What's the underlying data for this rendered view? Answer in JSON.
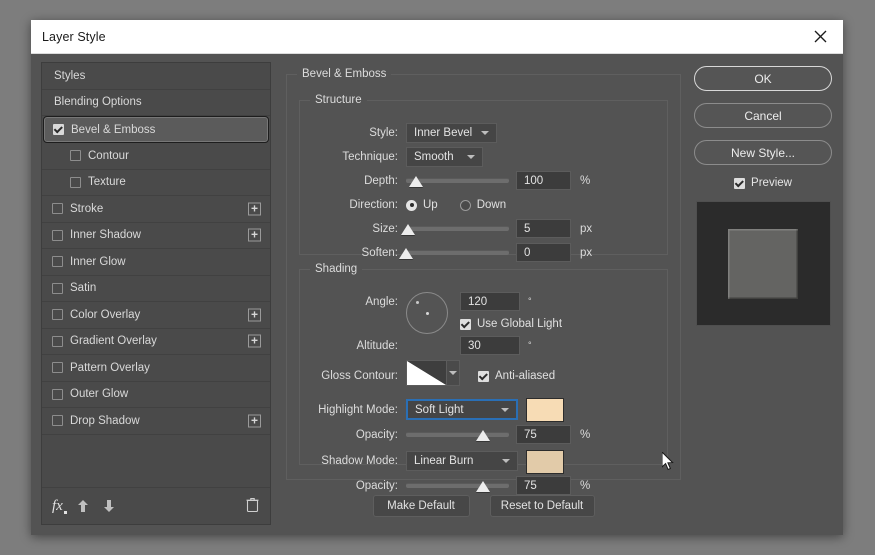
{
  "window": {
    "title": "Layer Style",
    "close_icon": "close-icon"
  },
  "styles_panel": {
    "items": [
      {
        "label": "Styles",
        "type": "plain",
        "checkbox": null,
        "plus": false
      },
      {
        "label": "Blending Options",
        "type": "plain",
        "checkbox": null,
        "plus": false
      },
      {
        "label": "Bevel & Emboss",
        "type": "selected",
        "checkbox": true,
        "plus": false
      },
      {
        "label": "Contour",
        "type": "indent",
        "checkbox": false,
        "plus": false
      },
      {
        "label": "Texture",
        "type": "indent",
        "checkbox": false,
        "plus": false
      },
      {
        "label": "Stroke",
        "type": "normal",
        "checkbox": false,
        "plus": true
      },
      {
        "label": "Inner Shadow",
        "type": "normal",
        "checkbox": false,
        "plus": true
      },
      {
        "label": "Inner Glow",
        "type": "normal",
        "checkbox": false,
        "plus": false
      },
      {
        "label": "Satin",
        "type": "normal",
        "checkbox": false,
        "plus": false
      },
      {
        "label": "Color Overlay",
        "type": "normal",
        "checkbox": false,
        "plus": true
      },
      {
        "label": "Gradient Overlay",
        "type": "normal",
        "checkbox": false,
        "plus": true
      },
      {
        "label": "Pattern Overlay",
        "type": "normal",
        "checkbox": false,
        "plus": false
      },
      {
        "label": "Outer Glow",
        "type": "normal",
        "checkbox": false,
        "plus": false
      },
      {
        "label": "Drop Shadow",
        "type": "normal",
        "checkbox": false,
        "plus": true
      }
    ],
    "footer": {
      "fx_icon": "fx-icon",
      "up_icon": "arrow-up-icon",
      "down_icon": "arrow-down-icon",
      "delete_icon": "trash-icon"
    }
  },
  "bevel_emboss": {
    "legend": "Bevel & Emboss",
    "structure": {
      "legend": "Structure",
      "style": {
        "label": "Style:",
        "value": "Inner Bevel"
      },
      "technique": {
        "label": "Technique:",
        "value": "Smooth"
      },
      "depth": {
        "label": "Depth:",
        "value": "100",
        "unit": "%",
        "percent": 10
      },
      "direction": {
        "label": "Direction:",
        "up_label": "Up",
        "down_label": "Down",
        "selected": "Up"
      },
      "size": {
        "label": "Size:",
        "value": "5",
        "unit": "px",
        "percent": 2
      },
      "soften": {
        "label": "Soften:",
        "value": "0",
        "unit": "px",
        "percent": 0
      }
    },
    "shading": {
      "legend": "Shading",
      "angle": {
        "label": "Angle:",
        "value": "120",
        "unit": "°"
      },
      "use_global_light": {
        "label": "Use Global Light",
        "checked": true
      },
      "altitude": {
        "label": "Altitude:",
        "value": "30",
        "unit": "°"
      },
      "gloss_contour": {
        "label": "Gloss Contour:"
      },
      "anti_aliased": {
        "label": "Anti-aliased",
        "checked": true
      },
      "highlight_mode": {
        "label": "Highlight Mode:",
        "value": "Soft Light",
        "color": "#f7dcb5",
        "focused": true
      },
      "highlight_opacity": {
        "label": "Opacity:",
        "value": "75",
        "unit": "%",
        "percent": 75
      },
      "shadow_mode": {
        "label": "Shadow Mode:",
        "value": "Linear Burn",
        "color": "#e2cba9"
      },
      "shadow_opacity": {
        "label": "Opacity:",
        "value": "75",
        "unit": "%",
        "percent": 75
      }
    }
  },
  "defaults": {
    "make_default": "Make Default",
    "reset_to_default": "Reset to Default"
  },
  "actions": {
    "ok": "OK",
    "cancel": "Cancel",
    "new_style": "New Style...",
    "preview": {
      "label": "Preview",
      "checked": true
    }
  },
  "colors": {
    "dialog_bg": "#535353",
    "panel_bg": "#4a4a4a",
    "titlebar_bg": "#ffffff",
    "focus_blue": "#2a6fb5",
    "highlight_swatch": "#f7dcb5",
    "shadow_swatch": "#e2cba9",
    "desktop_bg": "#7d7d7d"
  }
}
